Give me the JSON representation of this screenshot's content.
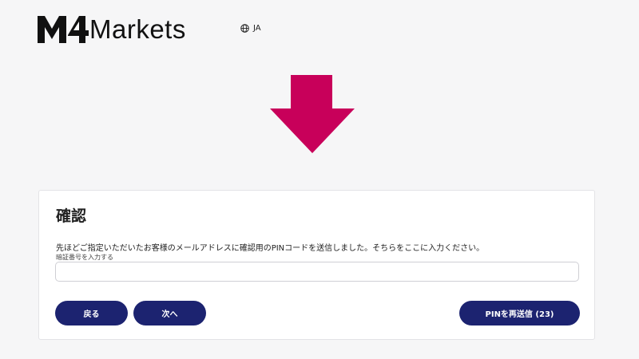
{
  "header": {
    "brand_text": "Markets",
    "brand_mark": "M4",
    "language": "JA",
    "language_icon": "globe-icon"
  },
  "indicator": {
    "icon": "arrow-down-icon",
    "color": "#c8005a"
  },
  "dialog": {
    "title": "確認",
    "message": "先ほどご指定いただいたお客様のメールアドレスに確認用のPINコードを送信しました。そちらをここに入力ください。",
    "pin_field": {
      "label": "暗証番号を入力する",
      "value": ""
    },
    "buttons": {
      "back": "戻る",
      "next": "次へ",
      "resend": "PINを再送信 (23)"
    }
  },
  "colors": {
    "primary_button": "#1c2370",
    "background": "#f6f6f7",
    "brand": "#111111"
  }
}
